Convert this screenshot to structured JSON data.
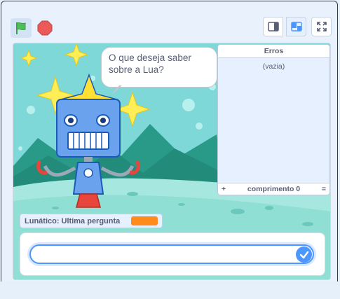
{
  "controls": {
    "green_flag_icon": "green-flag",
    "stop_icon": "stop-sign",
    "small_stage_icon": "small-stage",
    "normal_stage_icon": "normal-stage",
    "fullscreen_icon": "fullscreen"
  },
  "sprite": {
    "speech_text": "O que deseja saber sobre a Lua?"
  },
  "list_monitor": {
    "title": "Erros",
    "empty_label": "(vazia)",
    "add_symbol": "+",
    "length_label": "comprimento 0",
    "resize_symbol": "="
  },
  "variable_monitor": {
    "label": "Lunático: Ultima pergunta",
    "value_color": "#ff8c1a"
  },
  "ask_prompt": {
    "input_value": "",
    "submit_icon": "check-icon"
  },
  "colors": {
    "accent": "#4c97ff",
    "flag_green": "#4cbf56",
    "stop_red": "#ec5959"
  }
}
